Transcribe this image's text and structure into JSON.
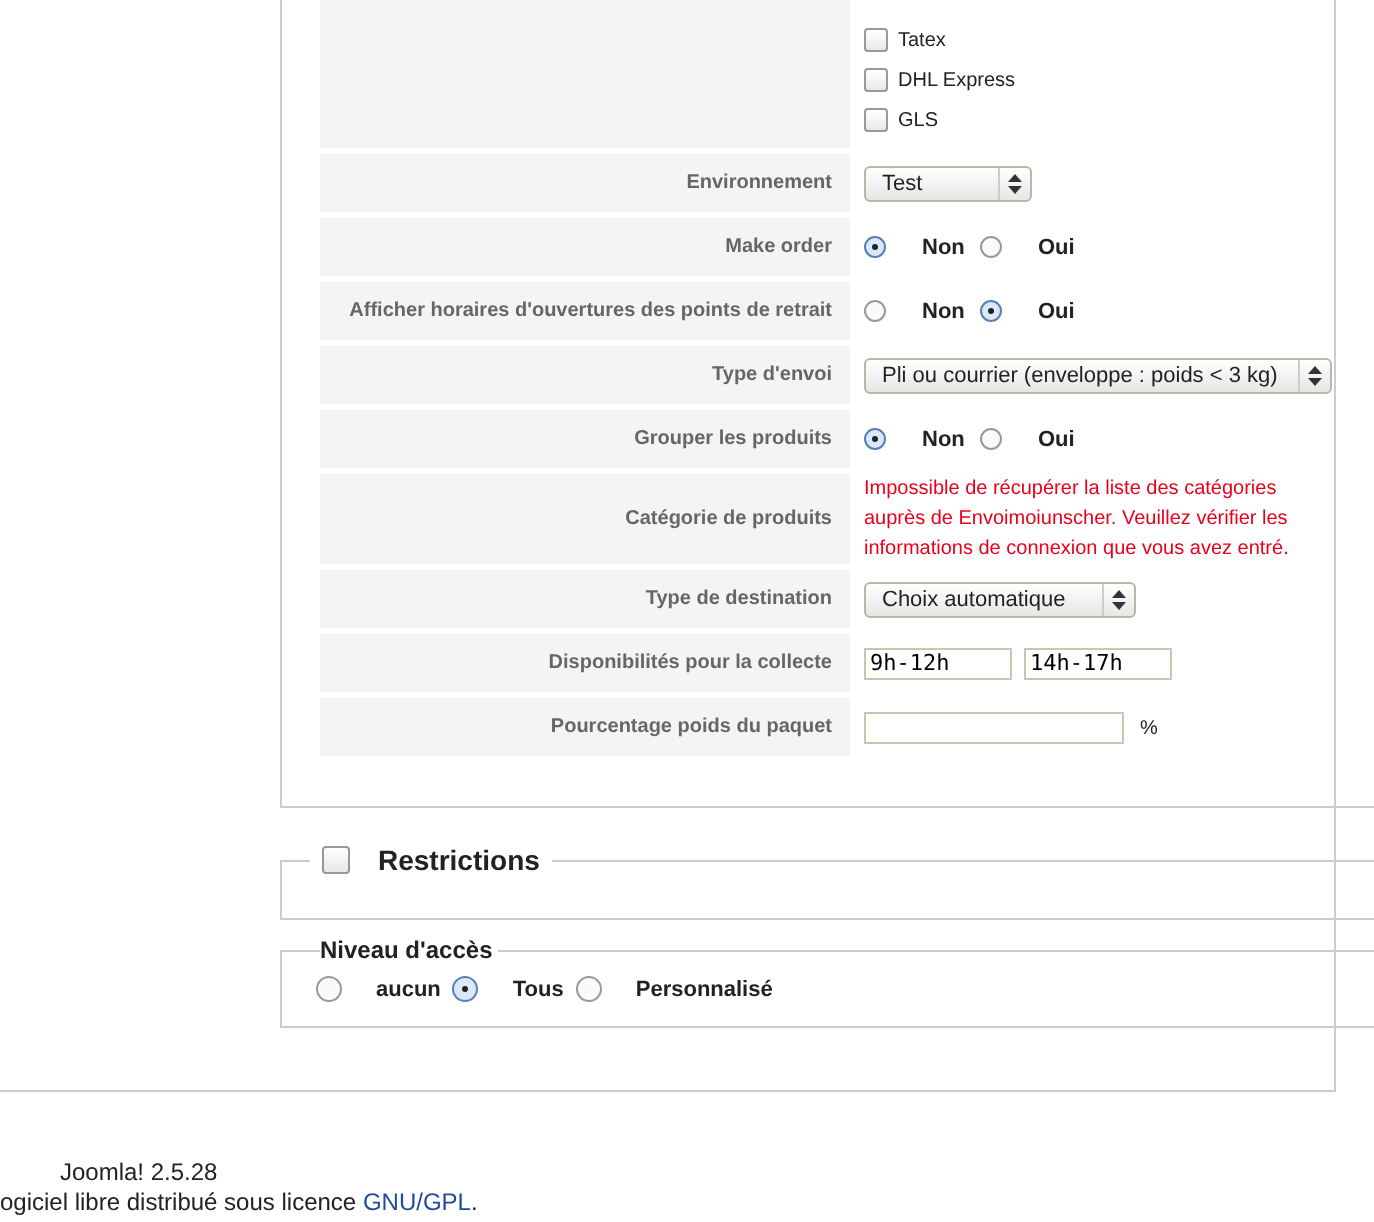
{
  "carriers": [
    {
      "label": "Tatex",
      "checked": false
    },
    {
      "label": "DHL Express",
      "checked": false
    },
    {
      "label": "GLS",
      "checked": false
    }
  ],
  "rows": [
    {
      "kind": "select",
      "label": "Environnement",
      "value": "Test"
    },
    {
      "kind": "radio",
      "label": "Make order",
      "options": [
        {
          "label": "Non",
          "selected": true
        },
        {
          "label": "Oui",
          "selected": false
        }
      ]
    },
    {
      "kind": "radio",
      "label": "Afficher horaires d'ouvertures des points de retrait",
      "options": [
        {
          "label": "Non",
          "selected": false
        },
        {
          "label": "Oui",
          "selected": true
        }
      ]
    },
    {
      "kind": "select",
      "label": "Type d'envoi",
      "value": "Pli ou courrier (enveloppe : poids < 3 kg)"
    },
    {
      "kind": "radio",
      "label": "Grouper les produits",
      "options": [
        {
          "label": "Non",
          "selected": true
        },
        {
          "label": "Oui",
          "selected": false
        }
      ]
    },
    {
      "kind": "error",
      "label": "Catégorie de produits",
      "message": "Impossible de récupérer la liste des catégories auprès de Envoimoiunscher. Veuillez vérifier les informations de connexion que vous avez entré."
    },
    {
      "kind": "select",
      "label": "Type de destination",
      "value": "Choix automatique"
    },
    {
      "kind": "inputs",
      "label": "Disponibilités pour la collecte",
      "values": [
        "9h-12h",
        "14h-17h"
      ]
    },
    {
      "kind": "unit",
      "label": "Pourcentage poids du paquet",
      "value": "",
      "unit": "%"
    }
  ],
  "restrictions": {
    "title": "Restrictions",
    "checked": false
  },
  "access_level": {
    "title": "Niveau d'accès",
    "options": [
      {
        "label": "aucun",
        "selected": false
      },
      {
        "label": "Tous",
        "selected": true
      },
      {
        "label": "Personnalisé",
        "selected": false
      }
    ]
  },
  "footer": {
    "version": "Joomla! 2.5.28",
    "license_text": "ogiciel libre distribué sous licence ",
    "license_link": "GNU/GPL",
    "license_end": "."
  }
}
